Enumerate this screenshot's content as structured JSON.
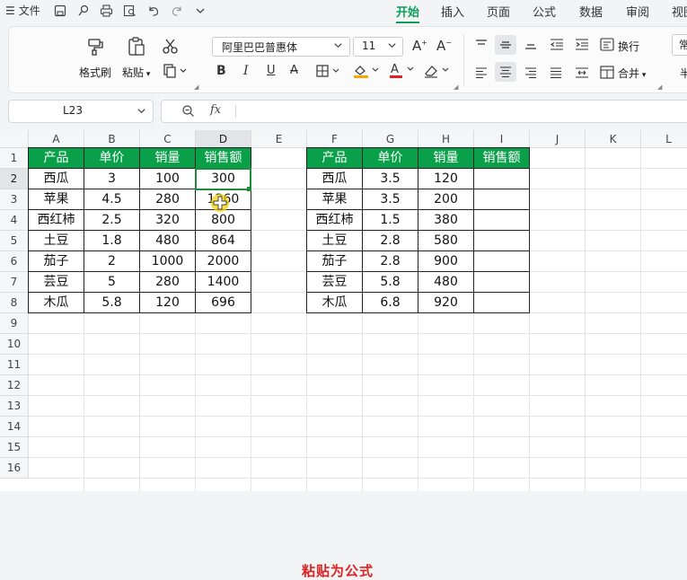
{
  "menu": {
    "file_label": "文件",
    "tabs": [
      {
        "label": "开始",
        "active": true
      },
      {
        "label": "插入"
      },
      {
        "label": "页面"
      },
      {
        "label": "公式"
      },
      {
        "label": "数据"
      },
      {
        "label": "审阅"
      },
      {
        "label": "视图"
      }
    ]
  },
  "ribbon": {
    "format_painter": "格式刷",
    "paste": "粘贴",
    "font_name": "阿里巴巴普惠体",
    "font_size": "11",
    "wrap": "换行",
    "merge": "合并",
    "clipped_left": "常",
    "clipped_bottom": "半"
  },
  "formula_bar": {
    "name_box": "L23",
    "fx": "fx",
    "formula": ""
  },
  "columns": [
    "A",
    "B",
    "C",
    "D",
    "E",
    "F",
    "G",
    "H",
    "I",
    "J",
    "K",
    "L"
  ],
  "rows": [
    "1",
    "2",
    "3",
    "4",
    "5",
    "6",
    "7",
    "8",
    "9",
    "10",
    "11",
    "12",
    "13",
    "14",
    "15",
    "16"
  ],
  "table1": {
    "headers": [
      "产品",
      "单价",
      "销量",
      "销售额"
    ],
    "rows": [
      [
        "西瓜",
        "3",
        "100",
        "300"
      ],
      [
        "苹果",
        "4.5",
        "280",
        "1260"
      ],
      [
        "西红柿",
        "2.5",
        "320",
        "800"
      ],
      [
        "土豆",
        "1.8",
        "480",
        "864"
      ],
      [
        "茄子",
        "2",
        "1000",
        "2000"
      ],
      [
        "芸豆",
        "5",
        "280",
        "1400"
      ],
      [
        "木瓜",
        "5.8",
        "120",
        "696"
      ]
    ]
  },
  "table2": {
    "headers": [
      "产品",
      "单价",
      "销量",
      "销售额"
    ],
    "rows": [
      [
        "西瓜",
        "3.5",
        "120",
        ""
      ],
      [
        "苹果",
        "3.5",
        "200",
        ""
      ],
      [
        "西红柿",
        "1.5",
        "380",
        ""
      ],
      [
        "土豆",
        "2.8",
        "580",
        ""
      ],
      [
        "茄子",
        "2.8",
        "900",
        ""
      ],
      [
        "芸豆",
        "5.8",
        "480",
        ""
      ],
      [
        "木瓜",
        "6.8",
        "920",
        ""
      ]
    ]
  },
  "caption": "粘贴为公式",
  "colors": {
    "accent": "#0d9e5c",
    "header_fill": "#0aa04a",
    "caption": "#e02020",
    "selection": "#1e8c3a",
    "cursor": "#f5d300"
  }
}
